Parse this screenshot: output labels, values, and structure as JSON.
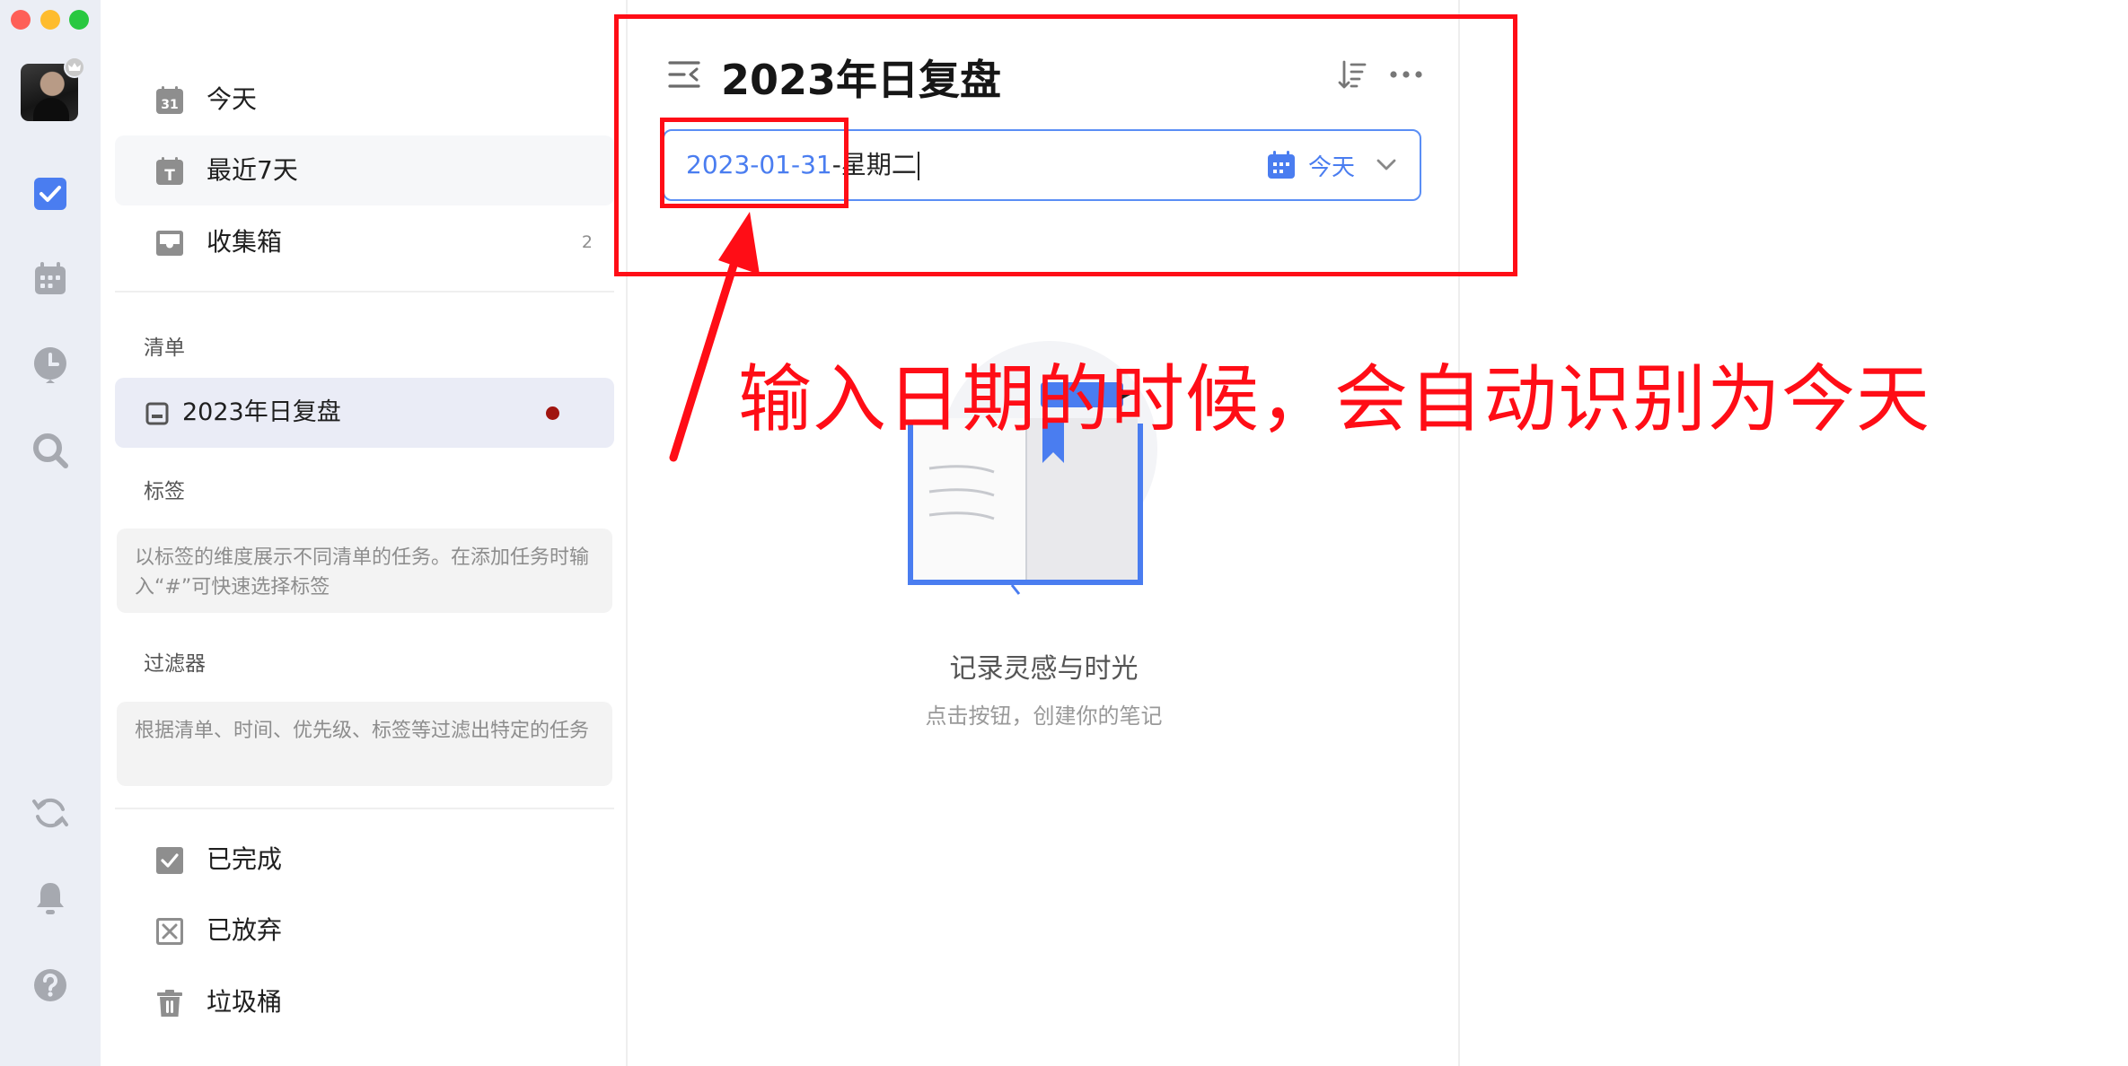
{
  "rail": {
    "icons": [
      "user-avatar",
      "task-checkbox-icon",
      "calendar-icon",
      "clock-icon",
      "search-icon",
      "sync-icon",
      "bell-icon",
      "help-icon"
    ],
    "accent": "#4a7df0"
  },
  "sidebar": {
    "smart_lists": [
      {
        "label": "今天",
        "icon": "calendar-31-icon",
        "calendar_number": "31"
      },
      {
        "label": "最近7天",
        "icon": "calendar-week-icon",
        "calendar_letter": "T"
      },
      {
        "label": "收集箱",
        "icon": "inbox-icon",
        "count": "2"
      }
    ],
    "lists_title": "清单",
    "lists": [
      {
        "label": "2023年日复盘",
        "icon": "note-list-icon",
        "dot_color": "#a0140f"
      }
    ],
    "tags_title": "标签",
    "tags_hint": "以标签的维度展示不同清单的任务。在添加任务时输入“#”可快速选择标签",
    "filters_title": "过滤器",
    "filters_hint": "根据清单、时间、优先级、标签等过滤出特定的任务",
    "bottom": [
      {
        "label": "已完成",
        "icon": "checked-box-icon"
      },
      {
        "label": "已放弃",
        "icon": "cancelled-box-icon"
      },
      {
        "label": "垃圾桶",
        "icon": "trash-icon"
      }
    ]
  },
  "main": {
    "title": "2023年日复盘",
    "input": {
      "date_part": "2023-01-31",
      "rest_part": "-星期二",
      "chip_label": "今天"
    },
    "empty": {
      "title": "记录灵感与时光",
      "subtitle": "点击按钮，创建你的笔记"
    }
  },
  "annotation": {
    "text": "输入日期的时候，会自动识别为今天",
    "color": "#ff0d16"
  }
}
